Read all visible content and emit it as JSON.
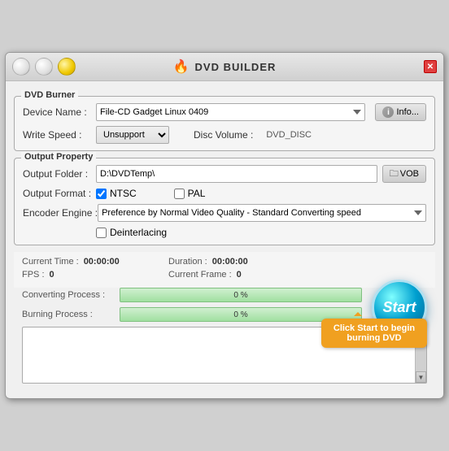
{
  "window": {
    "title": "DVD BUILDER",
    "close_label": "✕"
  },
  "traffic_lights": {
    "red": "red",
    "yellow": "yellow",
    "green": "green"
  },
  "dvd_burner": {
    "section_title": "DVD Burner",
    "device_name_label": "Device Name :",
    "device_name_value": "File-CD Gadget  Linux   0409",
    "info_label": "Info...",
    "write_speed_label": "Write Speed :",
    "write_speed_value": "Unsupport",
    "disc_volume_label": "Disc Volume :",
    "disc_volume_value": "DVD_DISC"
  },
  "output_property": {
    "section_title": "Output Property",
    "output_folder_label": "Output Folder :",
    "output_folder_value": "D:\\DVDTemp\\",
    "vob_label": "VOB",
    "output_format_label": "Output Format :",
    "ntsc_label": "NTSC",
    "ntsc_checked": true,
    "pal_label": "PAL",
    "pal_checked": false,
    "encoder_engine_label": "Encoder Engine :",
    "encoder_engine_value": "Preference by Normal Video Quality - Standard Converting speed",
    "deinterlacing_label": "Deinterlacing",
    "deinterlacing_checked": false
  },
  "stats": {
    "current_time_label": "Current Time :",
    "current_time_value": "00:00:00",
    "duration_label": "Duration :",
    "duration_value": "00:00:00",
    "fps_label": "FPS :",
    "fps_value": "0",
    "current_frame_label": "Current Frame :",
    "current_frame_value": "0"
  },
  "progress": {
    "converting_label": "Converting Process :",
    "converting_percent": "0 %",
    "converting_fill": 0,
    "burning_label": "Burning Process :",
    "burning_percent": "0 %",
    "burning_fill": 0
  },
  "start_button": {
    "label": "Start"
  },
  "tooltip": {
    "text": "Click Start to begin burning DVD"
  },
  "log": {
    "content": ""
  }
}
